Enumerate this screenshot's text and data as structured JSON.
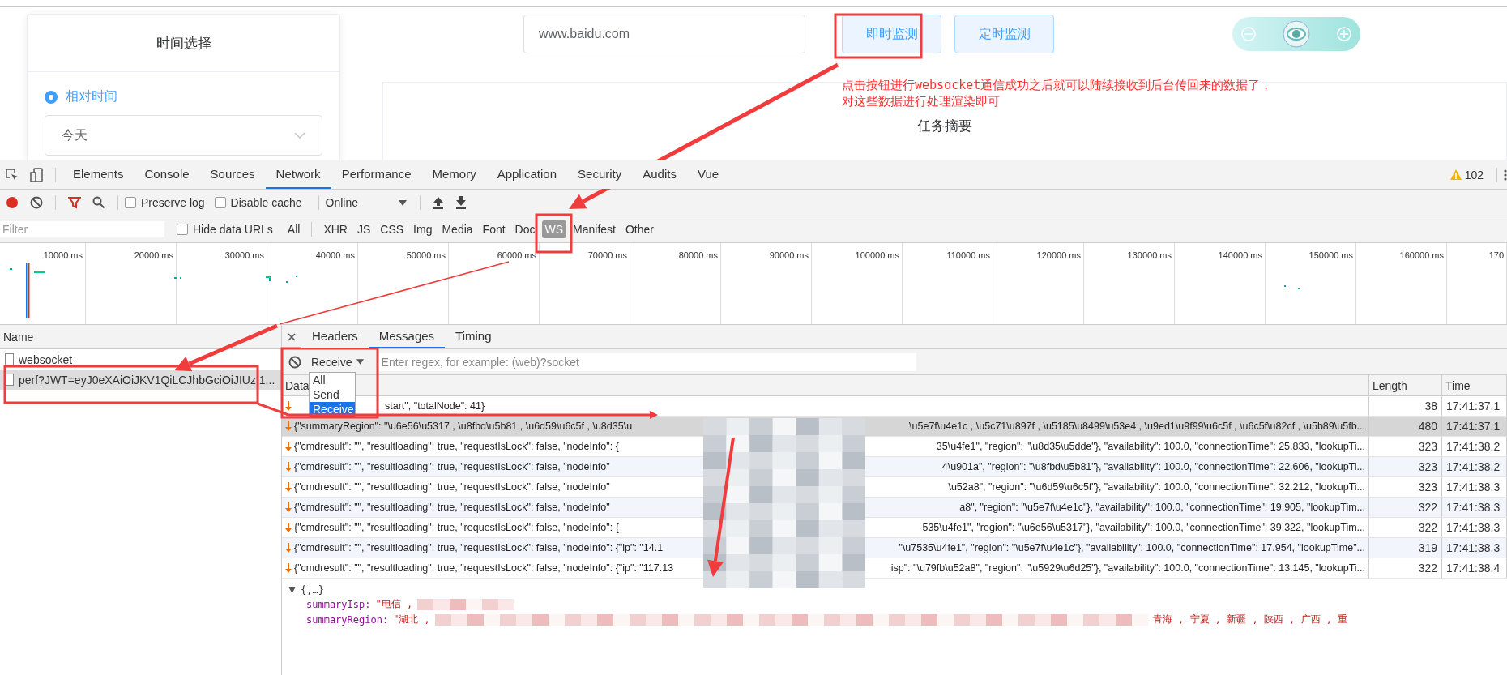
{
  "page": {
    "time_card": {
      "title": "时间选择",
      "radio": {
        "label": "相对时间",
        "selected": true
      },
      "select": {
        "value": "今天"
      }
    },
    "url_field": {
      "value": "www.baidu.com"
    },
    "buttons": [
      {
        "label": "即时监测"
      },
      {
        "label": "定时监测"
      }
    ],
    "note": [
      "点击按钮进行websocket通信成功之后就可以陆续接收到后台传回来的数据了，",
      "对这些数据进行处理渲染即可"
    ],
    "summary_card": {
      "title": "任务摘要"
    }
  },
  "devtools": {
    "tabs": [
      {
        "label": "Elements",
        "selected": false
      },
      {
        "label": "Console",
        "selected": false
      },
      {
        "label": "Sources",
        "selected": false
      },
      {
        "label": "Network",
        "selected": true
      },
      {
        "label": "Performance",
        "selected": false
      },
      {
        "label": "Memory",
        "selected": false
      },
      {
        "label": "Application",
        "selected": false
      },
      {
        "label": "Security",
        "selected": false
      },
      {
        "label": "Audits",
        "selected": false
      },
      {
        "label": "Vue",
        "selected": false
      }
    ],
    "warnings": "102",
    "toolbar": {
      "recording": true,
      "preserve_log": {
        "label": "Preserve log",
        "checked": false
      },
      "disable_cache": {
        "label": "Disable cache",
        "checked": false
      },
      "throttle": "Online"
    },
    "filter": {
      "placeholder": "Filter",
      "hide_data_urls": {
        "label": "Hide data URLs",
        "checked": false
      },
      "types": [
        {
          "label": "All",
          "selected": false
        },
        {
          "label": "XHR",
          "selected": false
        },
        {
          "label": "JS",
          "selected": false
        },
        {
          "label": "CSS",
          "selected": false
        },
        {
          "label": "Img",
          "selected": false
        },
        {
          "label": "Media",
          "selected": false
        },
        {
          "label": "Font",
          "selected": false
        },
        {
          "label": "Doc",
          "selected": false
        },
        {
          "label": "WS",
          "selected": true
        },
        {
          "label": "Manifest",
          "selected": false
        },
        {
          "label": "Other",
          "selected": false
        }
      ]
    },
    "timeline": {
      "ticks": [
        "10000 ms",
        "20000 ms",
        "30000 ms",
        "40000 ms",
        "50000 ms",
        "60000 ms",
        "70000 ms",
        "80000 ms",
        "90000 ms",
        "100000 ms",
        "110000 ms",
        "120000 ms",
        "130000 ms",
        "140000 ms",
        "150000 ms",
        "160000 ms",
        "170"
      ]
    },
    "requests": {
      "header": "Name",
      "items": [
        {
          "name": "websocket",
          "selected": false
        },
        {
          "name": "perf?JWT=eyJ0eXAiOiJKV1QiLCJhbGciOiJIUz 1...",
          "selected": true
        }
      ]
    },
    "detail_tabs": [
      {
        "label": "Headers",
        "selected": false
      },
      {
        "label": "Messages",
        "selected": true
      },
      {
        "label": "Timing",
        "selected": false
      }
    ],
    "message_filter": {
      "direction": "Receive",
      "placeholder": "Enter regex, for example: (web)?socket",
      "options": [
        {
          "label": "All",
          "selected": false
        },
        {
          "label": "Send",
          "selected": false
        },
        {
          "label": "Receive",
          "selected": true
        }
      ]
    },
    "messages": {
      "columns": [
        "Data",
        "Length",
        "Time"
      ],
      "rows": [
        {
          "start": "start\", \"totalNode\": 41}",
          "behind_menu": true,
          "length": "38",
          "time": "17:41:37.1",
          "selected": false
        },
        {
          "start": "{\"summaryRegion\": \"\\u6e56\\u5317 , \\u8fbd\\u5b81 , \\u6d59\\u6c5f , \\u8d35\\u",
          "end": "\\u5e7f\\u4e1c , \\u5c71\\u897f , \\u5185\\u8499\\u53e4 , \\u9ed1\\u9f99\\u6c5f , \\u6c5f\\u82cf , \\u5b89\\u5fb...",
          "length": "480",
          "time": "17:41:37.1",
          "selected": true
        },
        {
          "start": "{\"cmdresult\": \"\", \"resultloading\": true, \"requestIsLock\": false, \"nodeInfo\": {",
          "end": "35\\u4fe1\", \"region\": \"\\u8d35\\u5dde\"}, \"availability\": 100.0, \"connectionTime\": 25.833, \"lookupTi...",
          "length": "323",
          "time": "17:41:38.2",
          "selected": false
        },
        {
          "start": "{\"cmdresult\": \"\", \"resultloading\": true, \"requestIsLock\": false, \"nodeInfo\"",
          "end": "4\\u901a\", \"region\": \"\\u8fbd\\u5b81\"}, \"availability\": 100.0, \"connectionTime\": 22.606, \"lookupTi...",
          "length": "323",
          "time": "17:41:38.2",
          "selected": false
        },
        {
          "start": "{\"cmdresult\": \"\", \"resultloading\": true, \"requestIsLock\": false, \"nodeInfo\"",
          "end": "\\u52a8\", \"region\": \"\\u6d59\\u6c5f\"}, \"availability\": 100.0, \"connectionTime\": 32.212, \"lookupTi...",
          "length": "323",
          "time": "17:41:38.3",
          "selected": false
        },
        {
          "start": "{\"cmdresult\": \"\", \"resultloading\": true, \"requestIsLock\": false, \"nodeInfo\"",
          "end": "a8\", \"region\": \"\\u5e7f\\u4e1c\"}, \"availability\": 100.0, \"connectionTime\": 19.905, \"lookupTim...",
          "length": "322",
          "time": "17:41:38.3",
          "selected": false
        },
        {
          "start": "{\"cmdresult\": \"\", \"resultloading\": true, \"requestIsLock\": false, \"nodeInfo\": {",
          "end": "535\\u4fe1\", \"region\": \"\\u6e56\\u5317\"}, \"availability\": 100.0, \"connectionTime\": 39.322, \"lookupTim...",
          "length": "322",
          "time": "17:41:38.3",
          "selected": false
        },
        {
          "start": "{\"cmdresult\": \"\", \"resultloading\": true, \"requestIsLock\": false, \"nodeInfo\": {\"ip\": \"14.1",
          "end": "\"\\u7535\\u4fe1\", \"region\": \"\\u5e7f\\u4e1c\"}, \"availability\": 100.0, \"connectionTime\": 17.954, \"lookupTime\"...",
          "length": "319",
          "time": "17:41:38.3",
          "selected": false
        },
        {
          "start": "{\"cmdresult\": \"\", \"resultloading\": true, \"requestIsLock\": false, \"nodeInfo\": {\"ip\": \"117.13",
          "end": "isp\": \"\\u79fb\\u52a8\", \"region\": \"\\u5929\\u6d25\"}, \"availability\": 100.0, \"connectionTime\": 13.145, \"lookupTi...",
          "length": "322",
          "time": "17:41:38.4",
          "selected": false
        }
      ]
    },
    "preview": {
      "expanded": true,
      "root": "{,…}",
      "fields": [
        {
          "key": "summaryIsp:",
          "start": "\"电信 ,"
        },
        {
          "key": "summaryRegion:",
          "start": "\"湖北 ,",
          "end": "青海 , 宁夏 , 新疆 , 陕西 , 广西 , 重"
        }
      ]
    }
  }
}
